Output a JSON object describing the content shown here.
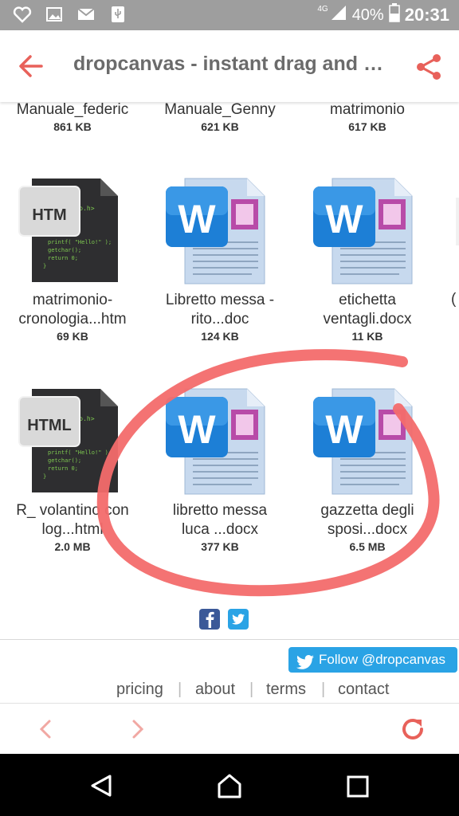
{
  "status_bar": {
    "network": "4G",
    "battery": "40%",
    "time": "20:31"
  },
  "toolbar": {
    "title": "dropcanvas - instant drag and drop"
  },
  "files_row0": [
    {
      "name": "Manuale_federic",
      "size": "861 KB"
    },
    {
      "name": "Manuale_Genny",
      "size": "621 KB"
    },
    {
      "name": "matrimonio",
      "size": "617 KB"
    }
  ],
  "files_row1": [
    {
      "name_line1": "matrimonio-",
      "name_line2": "cronologia...htm",
      "size": "69 KB",
      "type": "htm-icon",
      "badge": "HTM"
    },
    {
      "name_line1": "Libretto messa -",
      "name_line2": "rito...doc",
      "size": "124 KB",
      "type": "word-icon"
    },
    {
      "name_line1": "etichetta",
      "name_line2": "ventagli.docx",
      "size": "11 KB",
      "type": "word-icon"
    }
  ],
  "files_row2": [
    {
      "name_line1": "R_ volantino con",
      "name_line2": "log...html",
      "size": "2.0 MB",
      "type": "html-icon",
      "badge": "HTML"
    },
    {
      "name_line1": "libretto messa",
      "name_line2": "luca ...docx",
      "size": "377 KB",
      "type": "word-icon"
    },
    {
      "name_line1": "gazzetta degli",
      "name_line2": "sposi...docx",
      "size": "6.5 MB",
      "type": "word-icon"
    }
  ],
  "partial_edge_text": "(",
  "footer": {
    "follow_label": "Follow @dropcanvas",
    "links": [
      "pricing",
      "about",
      "terms",
      "contact"
    ],
    "separator": "|"
  },
  "colors": {
    "accent": "#e8615a",
    "twitter": "#2aa3e5",
    "word_blue": "#1d7fd6",
    "annotation": "#f36b6b"
  }
}
